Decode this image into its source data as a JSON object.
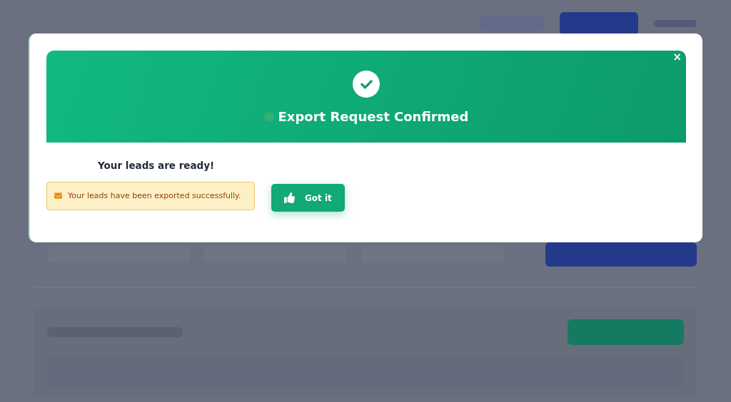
{
  "modal": {
    "title": "Export Request Confirmed",
    "close": "×",
    "heading": "Your leads are ready!",
    "alert": "Your leads have been exported successfully.",
    "button": "Got it"
  }
}
